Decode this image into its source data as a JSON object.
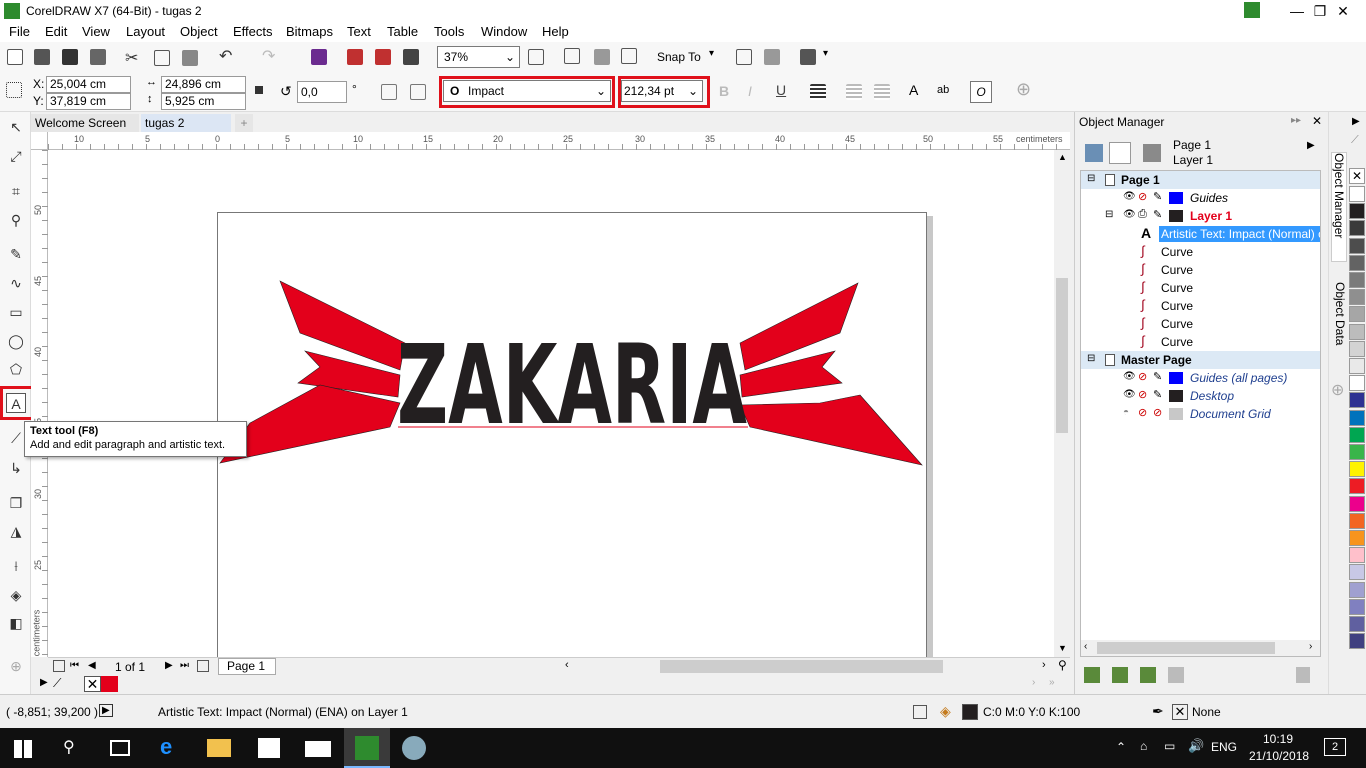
{
  "window": {
    "title": "CorelDRAW X7 (64-Bit) - tugas 2",
    "min": "—",
    "max": "❐",
    "close": "✕"
  },
  "menu": [
    "File",
    "Edit",
    "View",
    "Layout",
    "Object",
    "Effects",
    "Bitmaps",
    "Text",
    "Table",
    "Tools",
    "Window",
    "Help"
  ],
  "toolbar": {
    "zoom": "37%",
    "snap_to": "Snap To"
  },
  "props": {
    "x_label": "X:",
    "x": "25,004 cm",
    "y_label": "Y:",
    "y": "37,819 cm",
    "w": "24,896 cm",
    "h": "5,925 cm",
    "angle": "0,0",
    "deg": "°",
    "font": "Impact",
    "size": "212,34 pt"
  },
  "tabs": [
    "Welcome Screen",
    "tugas 2"
  ],
  "ruler": {
    "h_ticks": [
      "10",
      "5",
      "0",
      "5",
      "10",
      "15",
      "20",
      "25",
      "30",
      "35",
      "40",
      "45",
      "50",
      "55"
    ],
    "h_unit": "centimeters",
    "v_ticks": [
      "50",
      "45",
      "40",
      "35",
      "30",
      "25"
    ],
    "v_unit": "centimeters"
  },
  "artwork": {
    "text": "ZAKARIA",
    "accent": "#e3001b",
    "ink": "#231f20"
  },
  "tooltip": {
    "title": "Text tool (F8)",
    "desc": "Add and edit paragraph and artistic text."
  },
  "pager": {
    "count": "1 of 1",
    "page_tab": "Page 1"
  },
  "docker": {
    "title": "Object Manager",
    "page": "Page 1",
    "layer": "Layer 1",
    "rows": [
      {
        "label": "Page 1",
        "type": "page"
      },
      {
        "label": "Guides",
        "type": "layer",
        "color": "#0000ff"
      },
      {
        "label": "Layer 1",
        "type": "layer-active",
        "color": "#231f20"
      },
      {
        "label": "Artistic Text: Impact (Normal) on",
        "type": "text"
      },
      {
        "label": "Curve",
        "type": "curve"
      },
      {
        "label": "Curve",
        "type": "curve"
      },
      {
        "label": "Curve",
        "type": "curve"
      },
      {
        "label": "Curve",
        "type": "curve"
      },
      {
        "label": "Curve",
        "type": "curve"
      },
      {
        "label": "Curve",
        "type": "curve"
      },
      {
        "label": "Master Page",
        "type": "page"
      },
      {
        "label": "Guides (all pages)",
        "type": "master",
        "color": "#0000ff"
      },
      {
        "label": "Desktop",
        "type": "master",
        "color": "#231f20"
      },
      {
        "label": "Document Grid",
        "type": "master",
        "color": "#c8c8c8"
      }
    ],
    "side_tabs": [
      "Object Manager",
      "Object Data"
    ]
  },
  "status": {
    "coords": "( -8,851; 39,200 )",
    "info": "Artistic Text: Impact (Normal) (ENA) on Layer 1",
    "fill": "C:0 M:0 Y:0 K:100",
    "outline": "None"
  },
  "palette_colors": [
    "#ffffff",
    "#231f20",
    "#3a3a3a",
    "#4d4d4d",
    "#636363",
    "#7a7a7a",
    "#8f8f8f",
    "#a6a6a6",
    "#bcbcbc",
    "#d3d3d3",
    "#e9e9e9",
    "#ffffff",
    "#2e3192",
    "#0072bc",
    "#00a651",
    "#39b54a",
    "#fff200",
    "#ed1c24",
    "#ec008c",
    "#f26522",
    "#f7941d",
    "#ffc0cb",
    "#c8c8e6",
    "#a0a0d0",
    "#8080c0",
    "#6060a0",
    "#404080"
  ],
  "taskbar": {
    "lang": "ENG",
    "time": "10:19",
    "date": "21/10/2018",
    "notif": "2"
  }
}
